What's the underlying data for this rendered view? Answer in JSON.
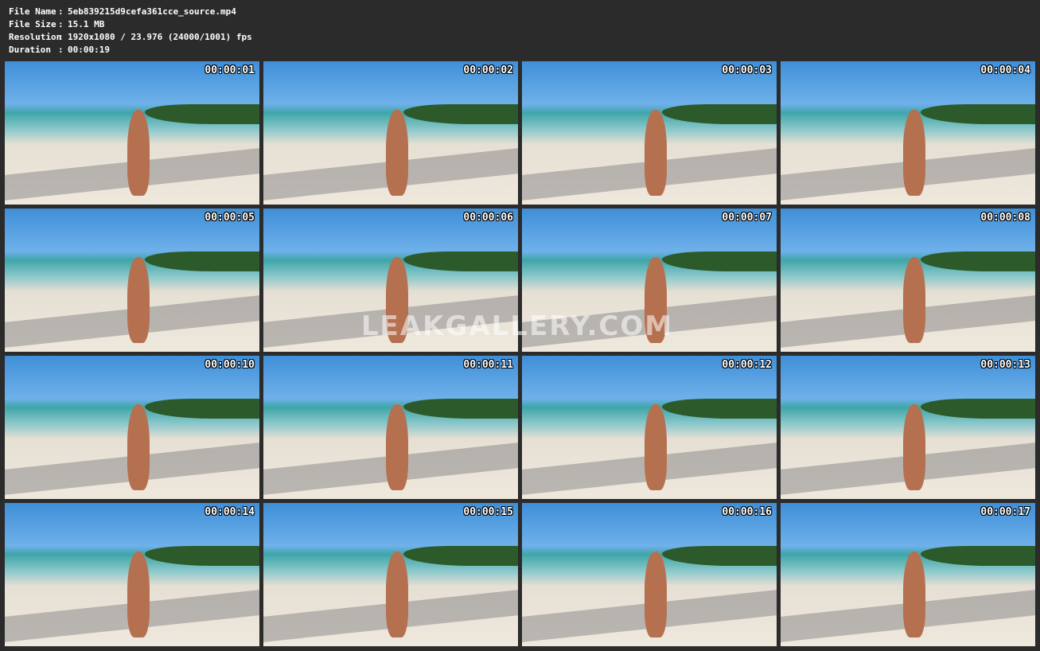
{
  "info": [
    {
      "key": "File Name",
      "value": "5eb839215d9cefa361cce_source.mp4"
    },
    {
      "key": "File Size",
      "value": "15.1 MB"
    },
    {
      "key": "Resolution",
      "value": "1920x1080 / 23.976 (24000/1001) fps"
    },
    {
      "key": "Duration",
      "value": "00:00:19"
    }
  ],
  "separator": ":",
  "frames": [
    "00:00:01",
    "00:00:02",
    "00:00:03",
    "00:00:04",
    "00:00:05",
    "00:00:06",
    "00:00:07",
    "00:00:08",
    "00:00:10",
    "00:00:11",
    "00:00:12",
    "00:00:13",
    "00:00:14",
    "00:00:15",
    "00:00:16",
    "00:00:17"
  ],
  "watermark": "LEAKGALLERY.COM",
  "colors": {
    "background": "#2b2b2b",
    "text": "#ffffff"
  }
}
